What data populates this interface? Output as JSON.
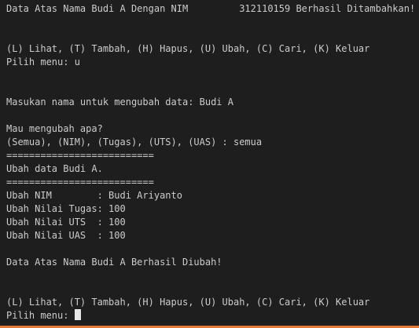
{
  "terminal": {
    "lines": [
      "Data Atas Nama Budi A Dengan NIM         312110159 Berhasil Ditambahkan!",
      "",
      "",
      "(L) Lihat, (T) Tambah, (H) Hapus, (U) Ubah, (C) Cari, (K) Keluar",
      "Pilih menu: u",
      "",
      "",
      "Masukan nama untuk mengubah data: Budi A",
      "",
      "Mau mengubah apa?",
      "(Semua), (NIM), (Tugas), (UTS), (UAS) : semua",
      "==========================",
      "Ubah data Budi A.",
      "==========================",
      "Ubah NIM        : Budi Ariyanto",
      "Ubah Nilai Tugas: 100",
      "Ubah Nilai UTS  : 100",
      "Ubah Nilai UAS  : 100",
      "",
      "Data Atas Nama Budi A Berhasil Diubah!",
      "",
      "",
      "(L) Lihat, (T) Tambah, (H) Hapus, (U) Ubah, (C) Cari, (K) Keluar"
    ],
    "prompt": "Pilih menu: "
  },
  "colors": {
    "background": "#1e1e1e",
    "text": "#cccccc",
    "cursor": "#e6e6e6",
    "status_bar": "#e07a3a"
  }
}
